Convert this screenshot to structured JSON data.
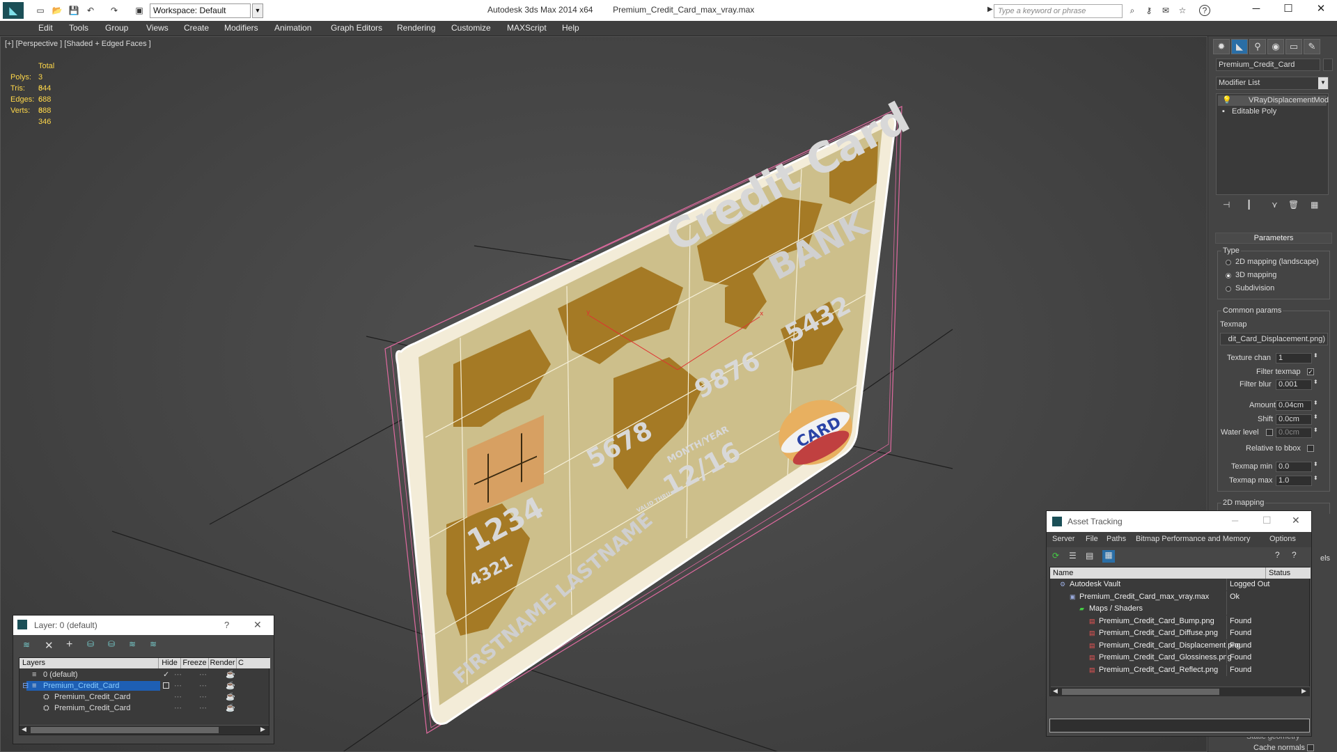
{
  "titlebar": {
    "app": "Autodesk 3ds Max  2014 x64",
    "file": "Premium_Credit_Card_max_vray.max",
    "workspace": "Workspace: Default",
    "search_placeholder": "Type a keyword or phrase"
  },
  "menu": [
    "Edit",
    "Tools",
    "Group",
    "Views",
    "Create",
    "Modifiers",
    "Animation",
    "Graph Editors",
    "Rendering",
    "Customize",
    "MAXScript",
    "Help"
  ],
  "viewport": {
    "label": "[+] [Perspective ] [Shaded + Edged Faces ]",
    "stats": {
      "header": "Total",
      "rows": [
        {
          "k": "Polys:",
          "v": "3 344"
        },
        {
          "k": "Tris:",
          "v": "6 688"
        },
        {
          "k": "Edges:",
          "v": "6 688"
        },
        {
          "k": "Verts:",
          "v": "3 346"
        }
      ]
    },
    "card": {
      "title": "Credit Card",
      "bank": "BANK",
      "num_a": "5678",
      "num_b": "9876",
      "num_c": "5432",
      "num_d": "1234",
      "small_num": "4321",
      "month_year": "MONTH/YEAR",
      "date": "12/16",
      "valid": "VALID THRU",
      "name": "FIRSTNAME LASTNAME",
      "logo": "CARD"
    }
  },
  "cmdpanel": {
    "object_name": "Premium_Credit_Card",
    "modifier_list": "Modifier List",
    "stack": [
      "VRayDisplacementMod",
      "Editable Poly"
    ],
    "parameters_title": "Parameters",
    "type_label": "Type",
    "type_options": [
      "2D mapping (landscape)",
      "3D mapping",
      "Subdivision"
    ],
    "type_selected": 1,
    "common_params": "Common params",
    "texmap_label": "Texmap",
    "texmap_value": "dit_Card_Displacement.png)",
    "texture_chan_label": "Texture chan",
    "texture_chan": "1",
    "filter_texmap": "Filter texmap",
    "filter_blur_label": "Filter blur",
    "filter_blur": "0.001",
    "amount_label": "Amount",
    "amount": "0.04cm",
    "shift_label": "Shift",
    "shift": "0.0cm",
    "water_level_label": "Water level",
    "water_level": "0.0cm",
    "relative_bbox": "Relative to bbox",
    "texmap_min_label": "Texmap min",
    "texmap_min": "0.0",
    "texmap_max_label": "Texmap max",
    "texmap_max": "1.0",
    "mapping_2d": "2D mapping",
    "cache_normals": "Cache normals",
    "static_geometry": "Static geometry",
    "els": "els"
  },
  "layer_dialog": {
    "title": "Layer: 0 (default)",
    "help": "?",
    "columns": [
      "Layers",
      "Hide",
      "Freeze",
      "Render",
      "C"
    ],
    "rows": [
      {
        "name": "0 (default)",
        "indent": 0,
        "selected": false,
        "check": true
      },
      {
        "name": "Premium_Credit_Card",
        "indent": 0,
        "selected": true,
        "check": false
      },
      {
        "name": "Premium_Credit_Card",
        "indent": 1,
        "selected": false,
        "check": false
      },
      {
        "name": "Premium_Credit_Card",
        "indent": 1,
        "selected": false,
        "check": false
      }
    ]
  },
  "asset_dialog": {
    "title": "Asset Tracking",
    "menu": [
      "Server",
      "File",
      "Paths",
      "Bitmap Performance and Memory",
      "Options"
    ],
    "columns": [
      "Name",
      "Status"
    ],
    "rows": [
      {
        "name": "Autodesk Vault",
        "status": "Logged Out",
        "indent": 0,
        "icon": "vault-icon"
      },
      {
        "name": "Premium_Credit_Card_max_vray.max",
        "status": "Ok",
        "indent": 1,
        "icon": "max-file-icon"
      },
      {
        "name": "Maps / Shaders",
        "status": "",
        "indent": 2,
        "icon": "folder-icon"
      },
      {
        "name": "Premium_Credit_Card_Bump.png",
        "status": "Found",
        "indent": 3,
        "icon": "png-icon"
      },
      {
        "name": "Premium_Credit_Card_Diffuse.png",
        "status": "Found",
        "indent": 3,
        "icon": "png-icon"
      },
      {
        "name": "Premium_Credit_Card_Displacement.png",
        "status": "Found",
        "indent": 3,
        "icon": "png-icon"
      },
      {
        "name": "Premium_Credit_Card_Glossiness.png",
        "status": "Found",
        "indent": 3,
        "icon": "png-icon"
      },
      {
        "name": "Premium_Credit_Card_Reflect.png",
        "status": "Found",
        "indent": 3,
        "icon": "png-icon"
      }
    ]
  },
  "colors": {
    "stats": "#ffd84a",
    "selection": "#1e5fb4",
    "card_base": "#cdbf8b",
    "card_map": "#a57a25"
  }
}
